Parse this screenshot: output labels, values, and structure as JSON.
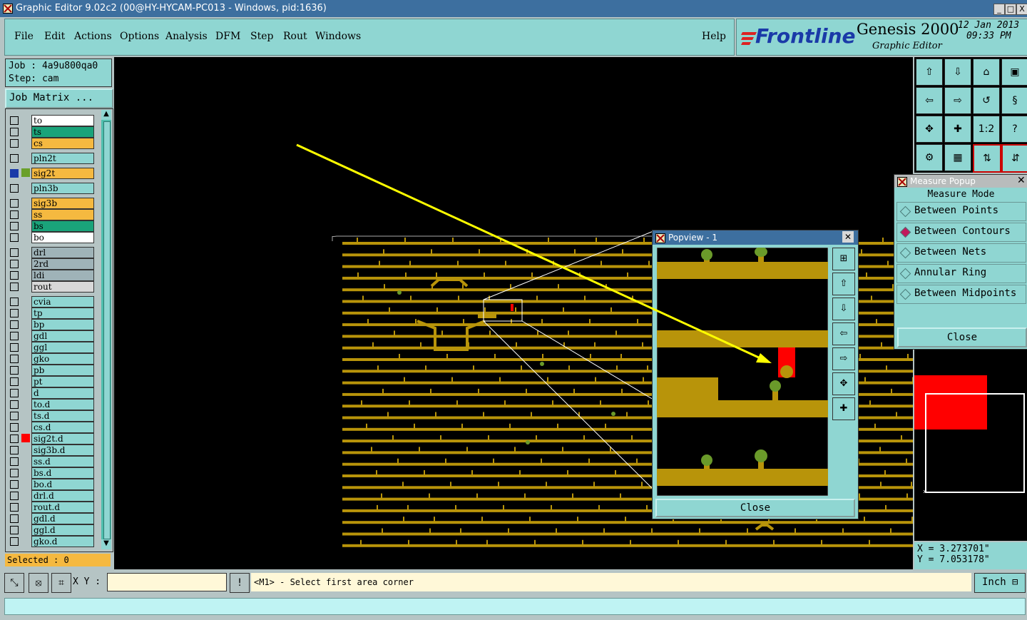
{
  "window": {
    "title": "Graphic Editor 9.02c2 (00@HY-HYCAM-PC013 - Windows, pid:1636)",
    "controls": [
      "_",
      "□",
      "X"
    ]
  },
  "menu": {
    "items": [
      "File",
      "Edit",
      "Actions",
      "Options",
      "Analysis",
      "DFM",
      "Step",
      "Rout",
      "Windows"
    ],
    "help": "Help"
  },
  "brand": {
    "logo": "Frontline",
    "product": "Genesis 2000",
    "subtitle": "Graphic Editor",
    "date": "12 Jan 2013",
    "time": "09:33 PM"
  },
  "job": {
    "job_line": "Job : 4a9u800qa0",
    "step_line": "Step: cam",
    "matrix_button": "Job Matrix ..."
  },
  "layers": [
    {
      "name": "to",
      "color": "#ffffff"
    },
    {
      "name": "ts",
      "color": "#1aa37a"
    },
    {
      "name": "cs",
      "color": "#f5b940"
    },
    {
      "name": "pln2t",
      "color": "#8fd6d2"
    },
    {
      "name": "sig2t",
      "color": "#f5b940",
      "active": true
    },
    {
      "name": "pln3b",
      "color": "#8fd6d2"
    },
    {
      "name": "sig3b",
      "color": "#f5b940"
    },
    {
      "name": "ss",
      "color": "#f5b940"
    },
    {
      "name": "bs",
      "color": "#1aa37a"
    },
    {
      "name": "bo",
      "color": "#ffffff"
    },
    {
      "name": "drl",
      "color": "#9fb3b8"
    },
    {
      "name": "2rd",
      "color": "#9fb3b8"
    },
    {
      "name": "ldi",
      "color": "#9fb3b8"
    },
    {
      "name": "rout",
      "color": "#d8d8d8"
    },
    {
      "name": "cvia",
      "color": "#8fd6d2"
    },
    {
      "name": "tp",
      "color": "#8fd6d2"
    },
    {
      "name": "bp",
      "color": "#8fd6d2"
    },
    {
      "name": "gdl",
      "color": "#8fd6d2"
    },
    {
      "name": "ggl",
      "color": "#8fd6d2"
    },
    {
      "name": "gko",
      "color": "#8fd6d2"
    },
    {
      "name": "pb",
      "color": "#8fd6d2"
    },
    {
      "name": "pt",
      "color": "#8fd6d2"
    },
    {
      "name": "d",
      "color": "#8fd6d2"
    },
    {
      "name": "to.d",
      "color": "#8fd6d2"
    },
    {
      "name": "ts.d",
      "color": "#8fd6d2"
    },
    {
      "name": "cs.d",
      "color": "#8fd6d2"
    },
    {
      "name": "sig2t.d",
      "color": "#8fd6d2"
    },
    {
      "name": "sig3b.d",
      "color": "#8fd6d2"
    },
    {
      "name": "ss.d",
      "color": "#8fd6d2"
    },
    {
      "name": "bs.d",
      "color": "#8fd6d2"
    },
    {
      "name": "bo.d",
      "color": "#8fd6d2"
    },
    {
      "name": "drl.d",
      "color": "#8fd6d2"
    },
    {
      "name": "rout.d",
      "color": "#8fd6d2"
    },
    {
      "name": "gdl.d",
      "color": "#8fd6d2"
    },
    {
      "name": "ggl.d",
      "color": "#8fd6d2"
    },
    {
      "name": "gko.d",
      "color": "#8fd6d2"
    }
  ],
  "selected": "Selected : 0",
  "measure_popup": {
    "title": "Measure Popup",
    "mode_label": "Measure Mode",
    "options": [
      "Between Points",
      "Between Contours",
      "Between Nets",
      "Annular Ring",
      "Between Midpoints"
    ],
    "selected_option": "Between Contours",
    "close": "Close"
  },
  "popview": {
    "title": "Popview - 1",
    "close": "Close"
  },
  "tools": {
    "ratio_label": "1:2",
    "help_label": "?"
  },
  "coords": {
    "x": "X = 3.273701\"",
    "y": "Y = 7.053178\""
  },
  "bottom": {
    "xy_label": "X Y :",
    "message": "<M1> - Select first area corner",
    "unit": "Inch"
  },
  "colors": {
    "trace": "#b8940a",
    "pad": "#6a9a2a",
    "highlight": "#ff0000",
    "annotation": "#ffff00"
  }
}
